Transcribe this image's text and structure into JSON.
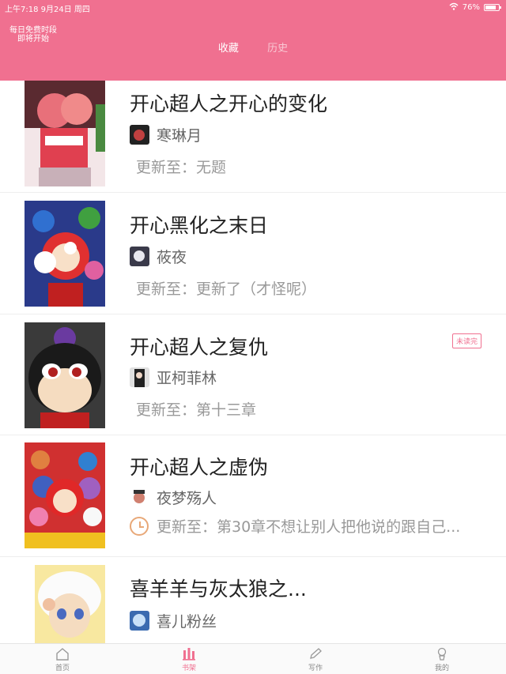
{
  "status_bar": {
    "time_date": "上午7:18  9月24日 周四",
    "battery": "76%"
  },
  "header": {
    "notice_line1": "每日免费时段",
    "notice_line2": "即将开始",
    "tabs": [
      "收藏",
      "历史"
    ]
  },
  "books": [
    {
      "title": "开心超人之开心的变化",
      "author": "寒琳月",
      "update": "更新至：无题"
    },
    {
      "title": "开心黑化之末日",
      "author": "莜夜",
      "update": "更新至：更新了（才怪呢）"
    },
    {
      "title": "开心超人之复仇",
      "author": "亚柯菲林",
      "update": "更新至：第十三章",
      "badge": "未读完"
    },
    {
      "title": "开心超人之虚伪",
      "author": "夜梦殇人",
      "update": "更新至：第30章不想让别人把他说的跟自己..."
    },
    {
      "title": "喜羊羊与灰太狼之...",
      "author": "喜儿粉丝",
      "update": ""
    }
  ],
  "bottom_nav": [
    "首页",
    "书架",
    "写作",
    "我的"
  ],
  "colors": {
    "brand": "#f07090"
  }
}
